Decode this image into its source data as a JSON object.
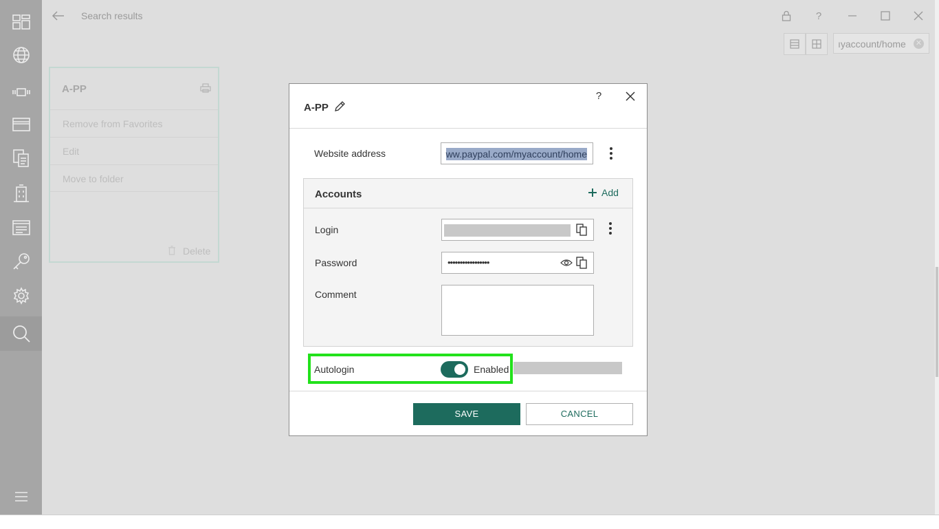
{
  "header": {
    "title": "Search results",
    "search_value": "ıyaccount/home"
  },
  "sidebar": {
    "items": [
      {
        "icon": "dashboard-icon"
      },
      {
        "icon": "globe-icon"
      },
      {
        "icon": "app-icon"
      },
      {
        "icon": "credit-card-icon"
      },
      {
        "icon": "documents-icon"
      },
      {
        "icon": "building-icon"
      },
      {
        "icon": "notes-icon"
      },
      {
        "icon": "key-icon"
      },
      {
        "icon": "gear-icon"
      },
      {
        "icon": "search-icon"
      }
    ]
  },
  "card": {
    "title": "A-PP",
    "menu": [
      "Remove from Favorites",
      "Edit",
      "Move to folder"
    ],
    "delete_label": "Delete"
  },
  "dialog": {
    "title": "A-PP",
    "help_label": "?",
    "website_label": "Website address",
    "website_value": "ww.paypal.com/myaccount/home",
    "accounts": {
      "title": "Accounts",
      "add_label": "Add",
      "login_label": "Login",
      "password_label": "Password",
      "password_value": "•••••••••••••••••",
      "comment_label": "Comment"
    },
    "autologin_label": "Autologin",
    "autologin_state": "Enabled",
    "save_label": "SAVE",
    "cancel_label": "CANCEL"
  },
  "colors": {
    "accent": "#1d6b5d",
    "highlight": "#22e11b",
    "selection": "#99aac8"
  }
}
